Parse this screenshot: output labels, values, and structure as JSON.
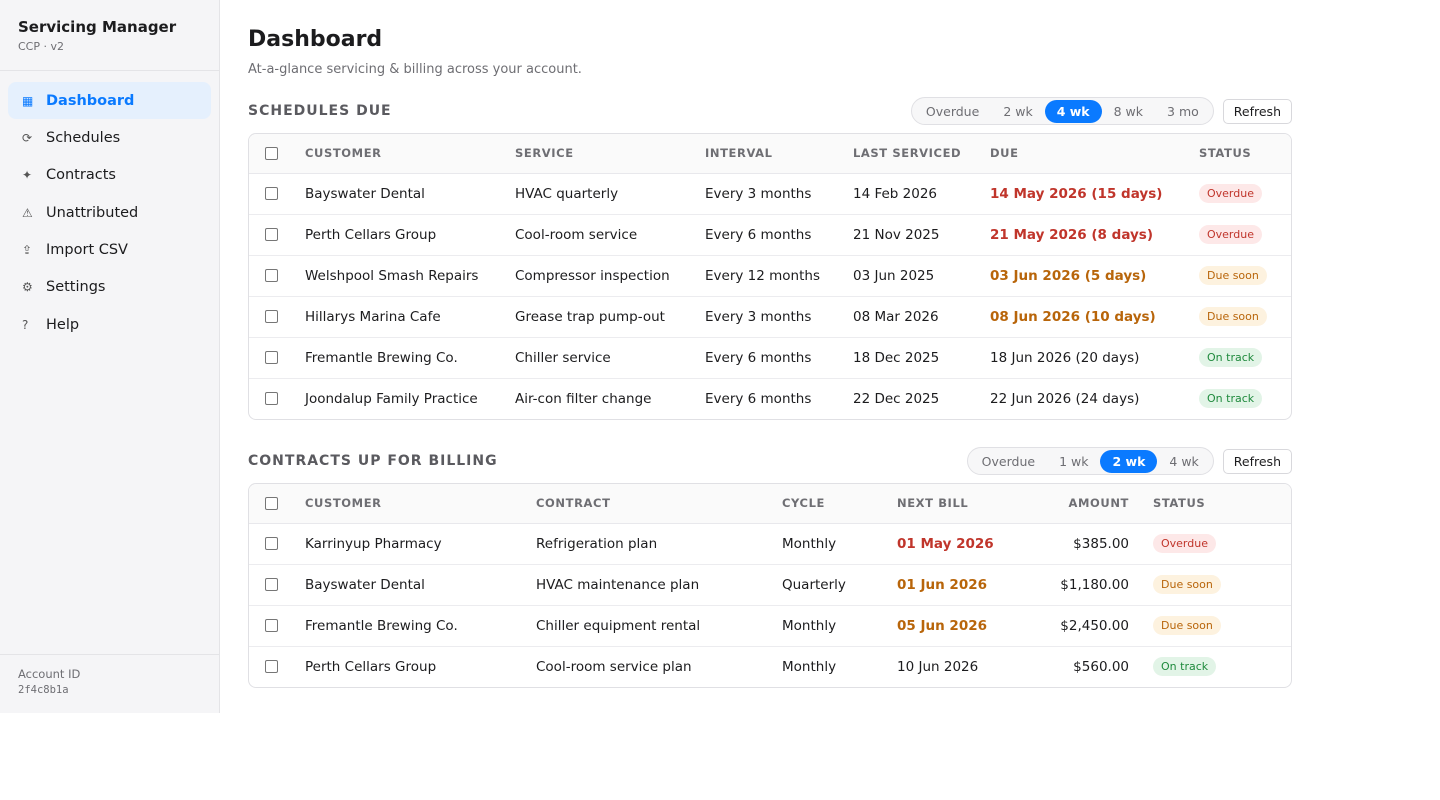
{
  "sidebar": {
    "title": "Servicing Manager",
    "subtitle": "CCP · v2",
    "items": [
      {
        "label": "Dashboard",
        "icon": "▦",
        "icon_name": "grid-icon",
        "active": true
      },
      {
        "label": "Schedules",
        "icon": "⟳",
        "icon_name": "refresh-icon",
        "active": false
      },
      {
        "label": "Contracts",
        "icon": "✦",
        "icon_name": "sparkle-icon",
        "active": false
      },
      {
        "label": "Unattributed",
        "icon": "⚠",
        "icon_name": "warning-icon",
        "active": false
      },
      {
        "label": "Import CSV",
        "icon": "⇪",
        "icon_name": "upload-icon",
        "active": false
      },
      {
        "label": "Settings",
        "icon": "⚙",
        "icon_name": "gear-icon",
        "active": false
      },
      {
        "label": "Help",
        "icon": "?",
        "icon_name": "help-icon",
        "active": false
      }
    ],
    "account_label": "Account ID",
    "account_id": "2f4c8b1a"
  },
  "header": {
    "title": "Dashboard",
    "subtitle": "At-a-glance servicing & billing across your account."
  },
  "schedules": {
    "title": "SCHEDULES DUE",
    "filters": [
      "Overdue",
      "2 wk",
      "4 wk",
      "8 wk",
      "3 mo"
    ],
    "active_filter": "4 wk",
    "refresh_label": "Refresh",
    "columns": [
      "CUSTOMER",
      "SERVICE",
      "INTERVAL",
      "LAST SERVICED",
      "DUE",
      "STATUS"
    ],
    "rows": [
      {
        "customer": "Bayswater Dental",
        "service": "HVAC quarterly",
        "interval": "Every 3 months",
        "last": "14 Feb 2026",
        "due": "14 May 2026 (15 days)",
        "status": "Overdue",
        "kind": "overdue"
      },
      {
        "customer": "Perth Cellars Group",
        "service": "Cool-room service",
        "interval": "Every 6 months",
        "last": "21 Nov 2025",
        "due": "21 May 2026 (8 days)",
        "status": "Overdue",
        "kind": "overdue"
      },
      {
        "customer": "Welshpool Smash Repairs",
        "service": "Compressor inspection",
        "interval": "Every 12 months",
        "last": "03 Jun 2025",
        "due": "03 Jun 2026 (5 days)",
        "status": "Due soon",
        "kind": "soon"
      },
      {
        "customer": "Hillarys Marina Cafe",
        "service": "Grease trap pump-out",
        "interval": "Every 3 months",
        "last": "08 Mar 2026",
        "due": "08 Jun 2026 (10 days)",
        "status": "Due soon",
        "kind": "soon"
      },
      {
        "customer": "Fremantle Brewing Co.",
        "service": "Chiller service",
        "interval": "Every 6 months",
        "last": "18 Dec 2025",
        "due": "18 Jun 2026 (20 days)",
        "status": "On track",
        "kind": "ontrack"
      },
      {
        "customer": "Joondalup Family Practice",
        "service": "Air-con filter change",
        "interval": "Every 6 months",
        "last": "22 Dec 2025",
        "due": "22 Jun 2026 (24 days)",
        "status": "On track",
        "kind": "ontrack"
      }
    ]
  },
  "billing": {
    "title": "CONTRACTS UP FOR BILLING",
    "filters": [
      "Overdue",
      "1 wk",
      "2 wk",
      "4 wk"
    ],
    "active_filter": "2 wk",
    "refresh_label": "Refresh",
    "columns": [
      "CUSTOMER",
      "CONTRACT",
      "CYCLE",
      "NEXT BILL",
      "AMOUNT",
      "STATUS"
    ],
    "rows": [
      {
        "customer": "Karrinyup Pharmacy",
        "contract": "Refrigeration plan",
        "cycle": "Monthly",
        "next": "01 May 2026",
        "amount": "$385.00",
        "status": "Overdue",
        "kind": "overdue"
      },
      {
        "customer": "Bayswater Dental",
        "contract": "HVAC maintenance plan",
        "cycle": "Quarterly",
        "next": "01 Jun 2026",
        "amount": "$1,180.00",
        "status": "Due soon",
        "kind": "soon"
      },
      {
        "customer": "Fremantle Brewing Co.",
        "contract": "Chiller equipment rental",
        "cycle": "Monthly",
        "next": "05 Jun 2026",
        "amount": "$2,450.00",
        "status": "Due soon",
        "kind": "soon"
      },
      {
        "customer": "Perth Cellars Group",
        "contract": "Cool-room service plan",
        "cycle": "Monthly",
        "next": "10 Jun 2026",
        "amount": "$560.00",
        "status": "On track",
        "kind": "ontrack"
      }
    ]
  }
}
